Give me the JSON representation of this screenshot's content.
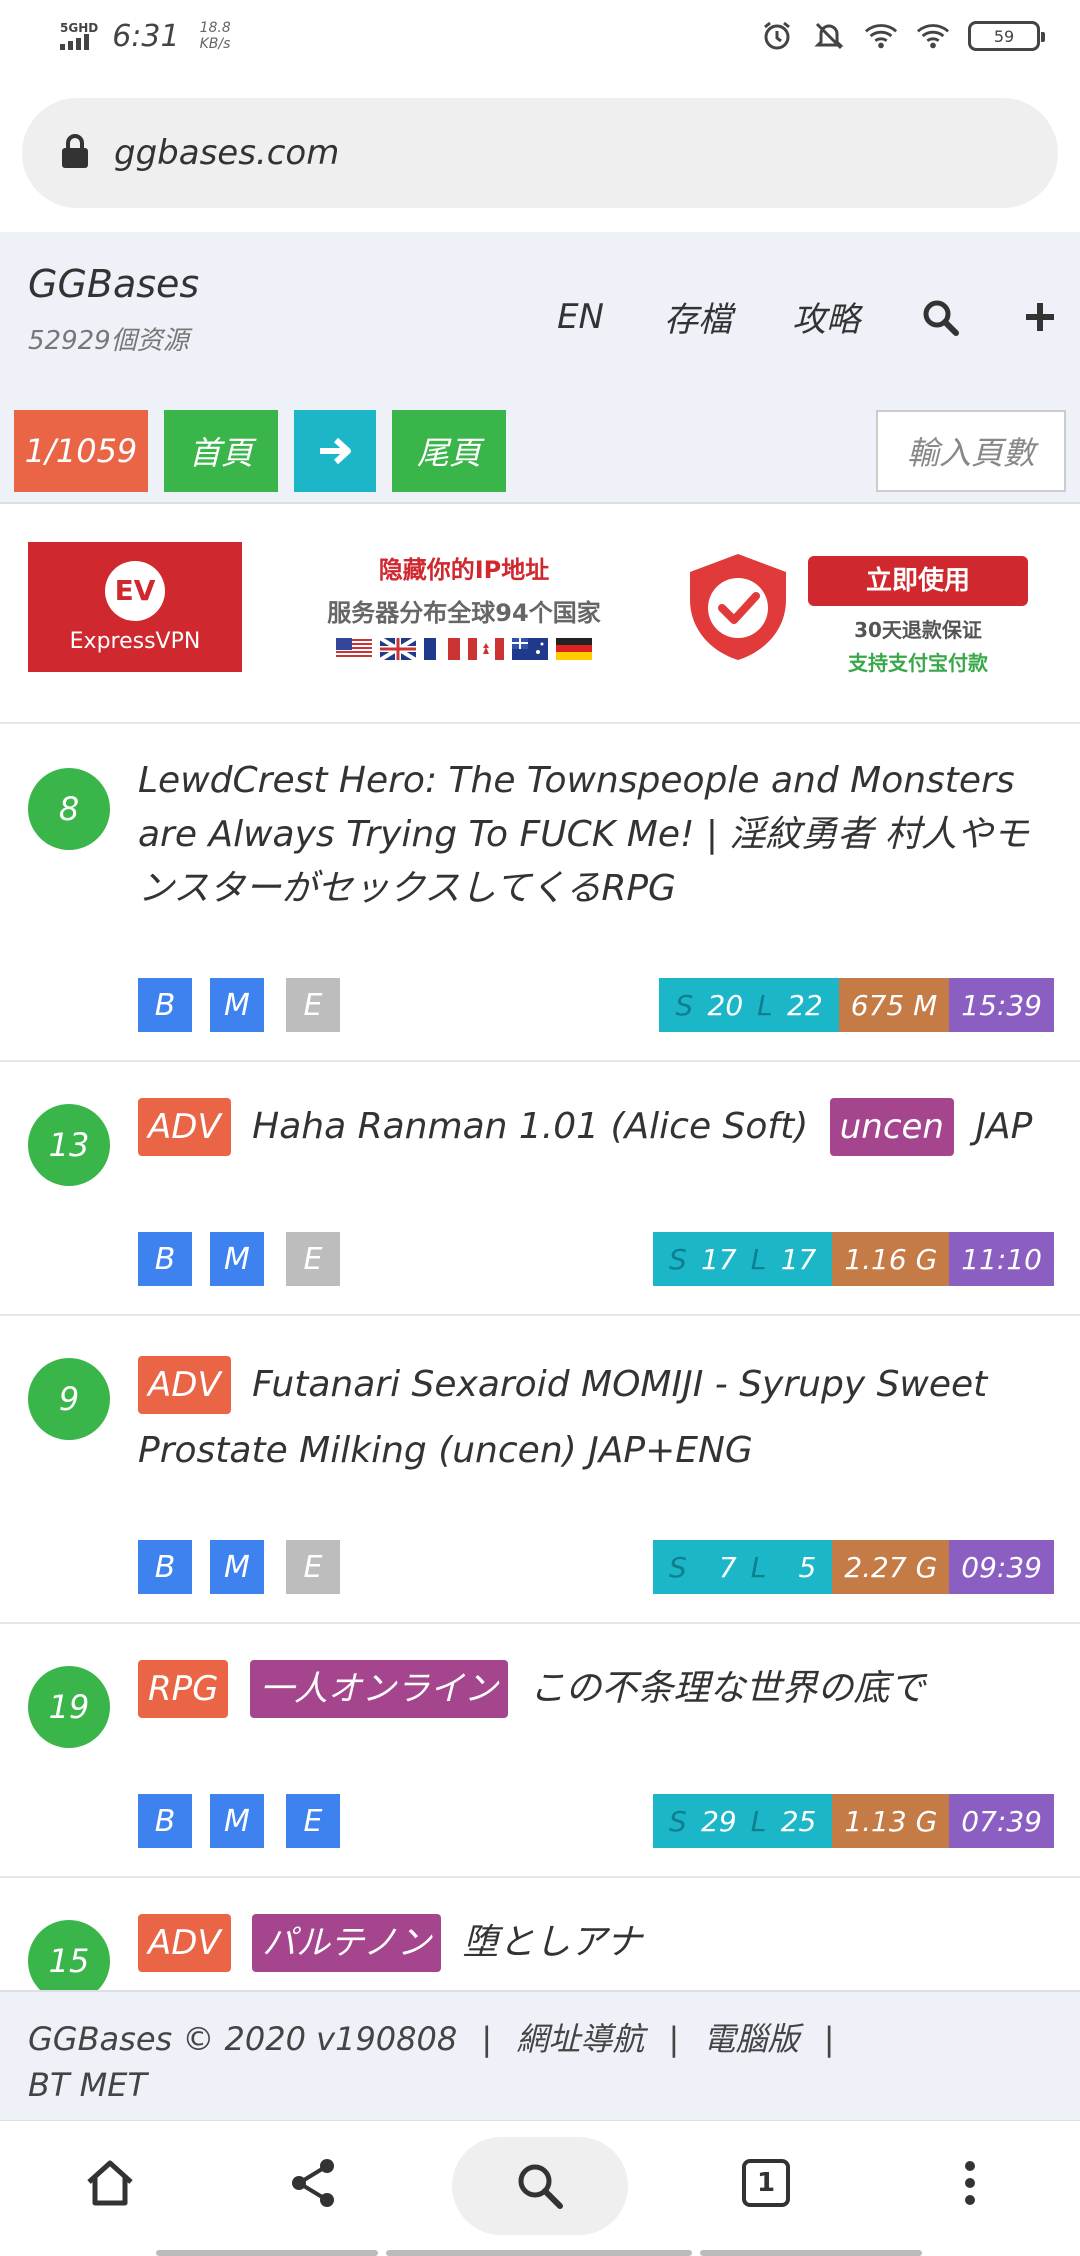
{
  "status_bar": {
    "network": "5GHD",
    "time": "6:31",
    "speed_value": "18.8",
    "speed_unit": "KB/s",
    "battery": "59"
  },
  "browser": {
    "url": "ggbases.com"
  },
  "site": {
    "title": "GGBases",
    "subtitle": "52929個资源",
    "nav": [
      "EN",
      "存檔",
      "攻略"
    ]
  },
  "pager": {
    "count": "1/1059",
    "first": "首頁",
    "last": "尾頁",
    "input_placeholder": "輸入頁數"
  },
  "ad": {
    "logo_text": "ExpressVPN",
    "logo_mark": "EV",
    "headline": "隐藏你的IP地址",
    "subline": "服务器分布全球94个国家",
    "button": "立即使用",
    "refund": "30天退款保证",
    "payment": "支持支付宝付款"
  },
  "items": [
    {
      "score": "8",
      "tags": [],
      "title": "LewdCrest Hero: The Townspeople and Monsters are Always Trying To FUCK Me! | 淫紋勇者 村人やモンスターがセックスしてくるRPG",
      "flags": {
        "b": "B",
        "m": "M",
        "e": "E"
      },
      "seeds_label": "S",
      "seeds": "20",
      "leech_label": "L",
      "leech": "22",
      "size": "675 M",
      "time": "15:39"
    },
    {
      "score": "13",
      "tags": [
        {
          "text": "ADV",
          "color": "orange"
        }
      ],
      "title": "Haha Ranman 1.01 (Alice Soft)",
      "tag_after": "uncen",
      "suffix": "JAP",
      "flags": {
        "b": "B",
        "m": "M",
        "e": "E"
      },
      "seeds_label": "S",
      "seeds": "17",
      "leech_label": "L",
      "leech": "17",
      "size": "1.16 G",
      "time": "11:10"
    },
    {
      "score": "9",
      "tags": [
        {
          "text": "ADV",
          "color": "orange"
        }
      ],
      "title": "Futanari Sexaroid MOMIJI - Syrupy Sweet Prostate Milking (uncen) JAP+ENG",
      "flags": {
        "b": "B",
        "m": "M",
        "e": "E"
      },
      "seeds_label": "S",
      "seeds": "7",
      "leech_label": "L",
      "leech": "5",
      "size": "2.27 G",
      "time": "09:39"
    },
    {
      "score": "19",
      "tags": [
        {
          "text": "RPG",
          "color": "orange"
        },
        {
          "text": "一人オンライン",
          "color": "purple"
        }
      ],
      "title": "この不条理な世界の底で",
      "flags": {
        "b": "B",
        "m": "M",
        "e": "E"
      },
      "seeds_label": "S",
      "seeds": "29",
      "leech_label": "L",
      "leech": "25",
      "size": "1.13 G",
      "time": "07:39"
    },
    {
      "score": "15",
      "tags": [
        {
          "text": "ADV",
          "color": "orange"
        },
        {
          "text": "パルテノン",
          "color": "purple"
        }
      ],
      "title": "堕としアナ"
    }
  ],
  "footer": {
    "copyright": "GGBases © 2020 v190808",
    "sep": "|",
    "links": [
      "網址導航",
      "電腦版"
    ],
    "tail": "BT MET"
  },
  "bottom_nav": {
    "tab_count": "1"
  },
  "colors": {
    "accent_orange": "#ea6446",
    "accent_green": "#39b54a",
    "accent_cyan": "#1cb6c9",
    "accent_blue": "#3d82ef",
    "accent_purple": "#a5458d"
  }
}
